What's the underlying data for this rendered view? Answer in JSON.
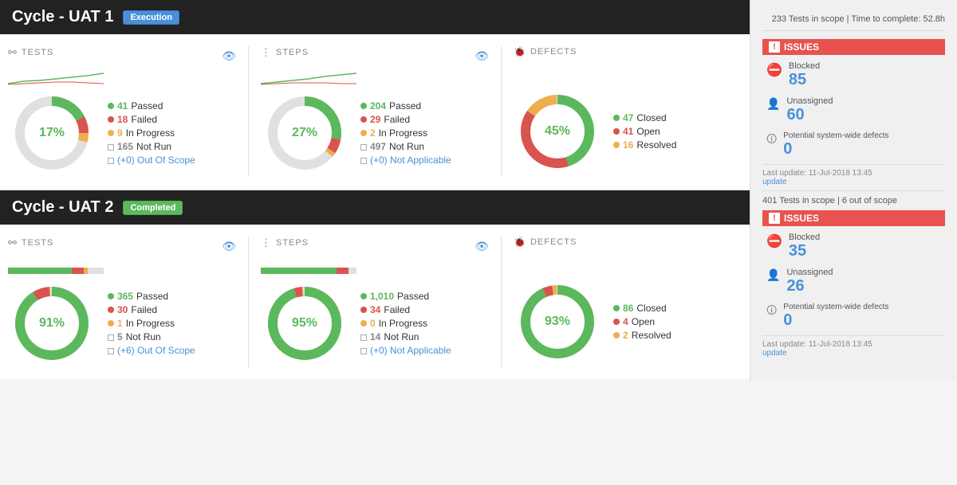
{
  "header": {
    "top_info_1": "233 Tests in scope | Time to complete: 52.8h",
    "top_info_2": "401 Tests in scope | 6 out of scope"
  },
  "cycle1": {
    "title": "Cycle - UAT 1",
    "badge": "Execution",
    "badge_type": "execution",
    "tests": {
      "label": "TESTS",
      "percent": "17%",
      "passed": "41",
      "failed": "18",
      "in_progress": "9",
      "not_run": "165",
      "out_of_scope": "(+0) Out Of Scope"
    },
    "steps": {
      "label": "STEPS",
      "percent": "27%",
      "passed": "204",
      "failed": "29",
      "in_progress": "2",
      "not_run": "497",
      "not_applicable": "(+0) Not Applicable"
    },
    "defects": {
      "label": "DEFECTS",
      "percent": "45%",
      "closed": "47",
      "open": "41",
      "resolved": "16"
    },
    "issues": {
      "label": "ISSUES",
      "blocked_label": "Blocked",
      "blocked": "85",
      "unassigned_label": "Unassigned",
      "unassigned": "60",
      "potential_label": "Potential system-wide defects",
      "potential": "0",
      "last_update_label": "Last update: 11-Jul-2018 13:45",
      "update_link": "update"
    }
  },
  "cycle2": {
    "title": "Cycle - UAT 2",
    "badge": "Completed",
    "badge_type": "completed",
    "tests": {
      "label": "TESTS",
      "percent": "91%",
      "passed": "365",
      "failed": "30",
      "in_progress": "1",
      "not_run": "5",
      "out_of_scope": "(+6) Out Of Scope"
    },
    "steps": {
      "label": "STEPS",
      "percent": "95%",
      "passed": "1,010",
      "failed": "34",
      "in_progress": "0",
      "not_run": "14",
      "not_applicable": "(+0) Not Applicable"
    },
    "defects": {
      "label": "DEFECTS",
      "percent": "93%",
      "closed": "86",
      "open": "4",
      "resolved": "2"
    },
    "issues": {
      "label": "ISSUES",
      "blocked_label": "Blocked",
      "blocked": "35",
      "unassigned_label": "Unassigned",
      "unassigned": "26",
      "potential_label": "Potential system-wide defects",
      "potential": "0",
      "last_update_label": "Last update: 11-Jul-2018 13:45",
      "update_link": "update"
    }
  },
  "labels": {
    "passed": "Passed",
    "failed": "Failed",
    "in_progress": "In Progress",
    "not_run": "Not Run",
    "closed": "Closed",
    "open": "Open",
    "resolved": "Resolved"
  },
  "colors": {
    "green": "#5cb85c",
    "red": "#d9534f",
    "yellow": "#f0ad4e",
    "gray": "#cccccc",
    "blue": "#4a90d9",
    "dark_gray": "#888888"
  }
}
